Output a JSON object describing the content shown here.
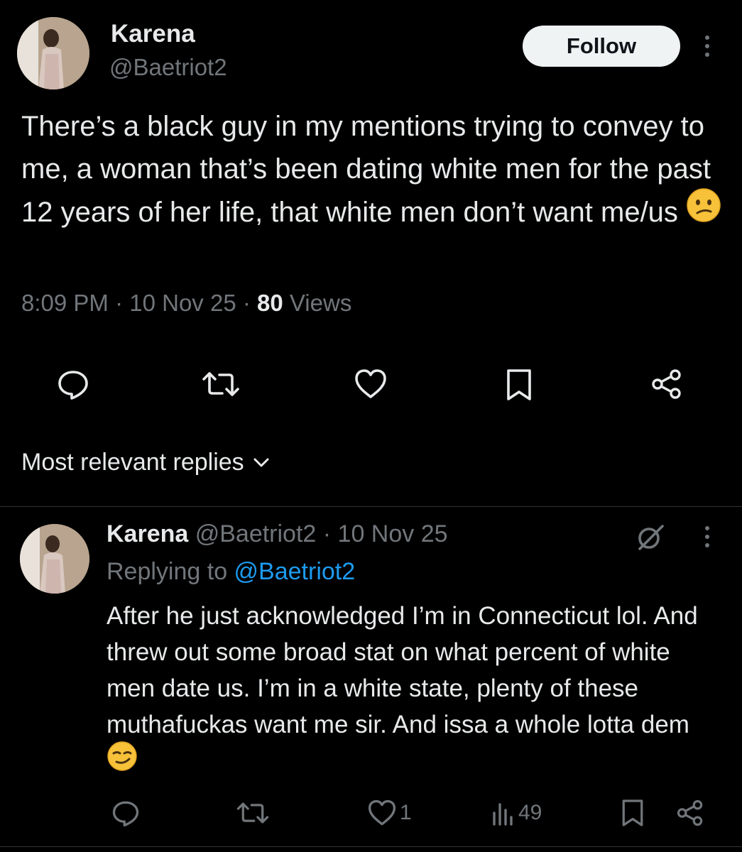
{
  "tweet": {
    "display_name": "Karena",
    "handle": "@Baetriot2",
    "follow_label": "Follow",
    "text": "There’s a black guy in my mentions trying to convey to me, a woman that’s been dating white men for the past 12 years of her life, that white men don’t want me/us",
    "emoji": "confused-face",
    "time": "8:09 PM",
    "sep1": " · ",
    "date": "10 Nov 25",
    "sep2": " · ",
    "views_count": "80",
    "views_label": " Views",
    "actions": [
      "reply-icon",
      "retweet-icon",
      "like-icon",
      "bookmark-icon",
      "share-icon"
    ]
  },
  "replies_sort": {
    "label": "Most relevant replies"
  },
  "reply": {
    "display_name": "Karena",
    "handle_date": " @Baetriot2 · 10 Nov 25",
    "replying_prefix": "Replying to ",
    "replying_handle": "@Baetriot2",
    "text": "After he just acknowledged I’m in Connecticut lol. And threw out some broad stat on what percent of white men date us. I’m in a white state, plenty of these muthafuckas want me sir. And issa a whole lotta dem",
    "emoji": "smirking-face",
    "likes": "1",
    "views": "49"
  },
  "colors": {
    "background": "#000000",
    "text": "#e7e9ea",
    "muted": "#71767b",
    "link": "#1d9bf0",
    "divider": "#2f3336",
    "follow_bg": "#eff3f4"
  }
}
